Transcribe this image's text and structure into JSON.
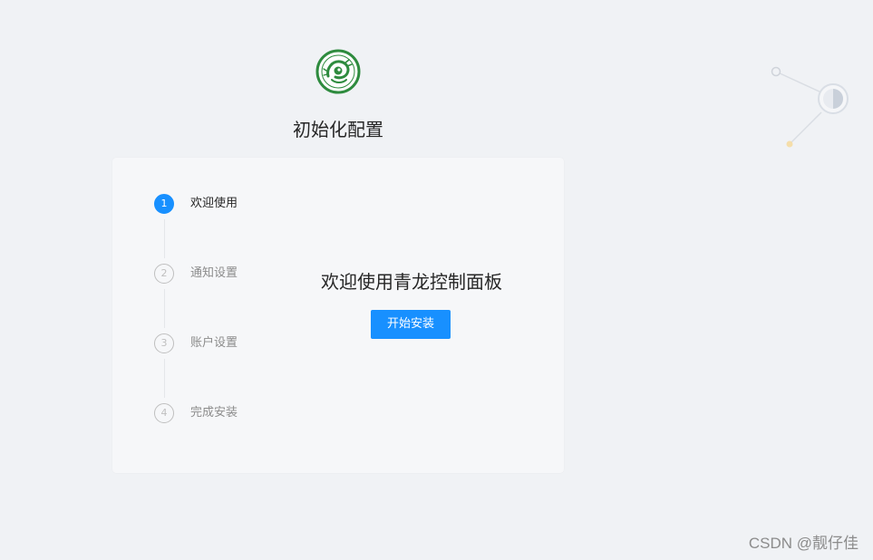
{
  "header": {
    "logo_icon": "qinglong-dragon-logo-icon",
    "title": "初始化配置"
  },
  "steps": [
    {
      "number": "1",
      "label": "欢迎使用",
      "state": "active"
    },
    {
      "number": "2",
      "label": "通知设置",
      "state": "pending"
    },
    {
      "number": "3",
      "label": "账户设置",
      "state": "pending"
    },
    {
      "number": "4",
      "label": "完成安装",
      "state": "pending"
    }
  ],
  "content": {
    "welcome_title": "欢迎使用青龙控制面板",
    "start_button_label": "开始安装"
  },
  "decoration_icon": "node-graph-decoration-icon",
  "watermark": "CSDN @靓仔佳",
  "colors": {
    "primary": "#1890ff",
    "background": "#f0f2f5",
    "card": "#f6f7f9",
    "logo_green": "#2e8b3e"
  }
}
